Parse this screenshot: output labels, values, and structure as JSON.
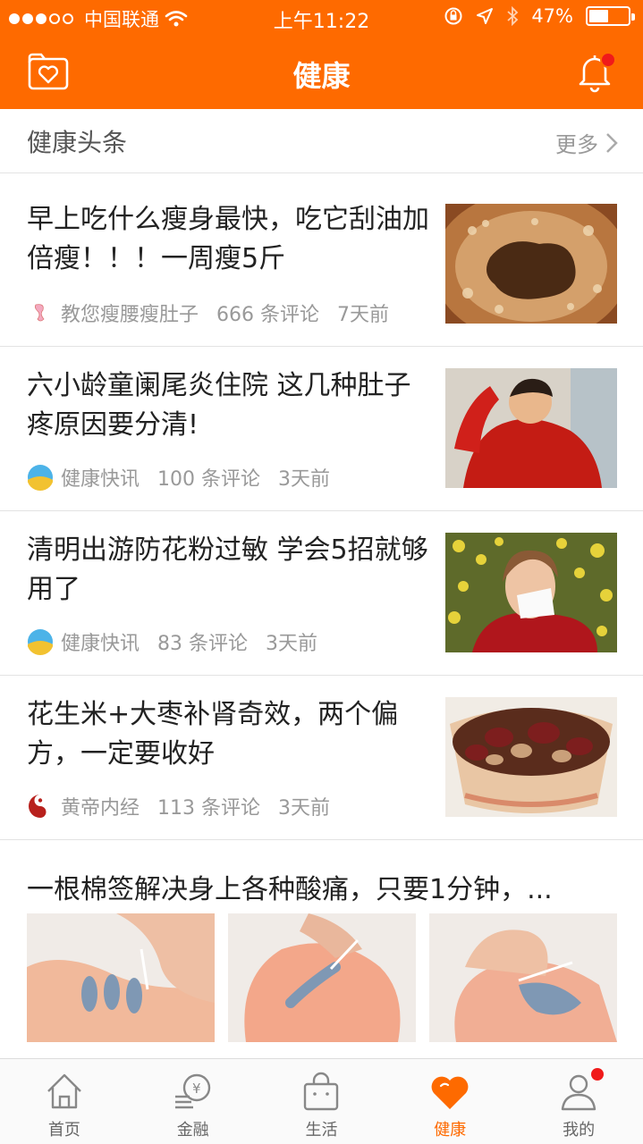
{
  "status_bar": {
    "carrier": "中国联通",
    "time": "上午11:22",
    "battery": "47%"
  },
  "nav": {
    "title": "健康"
  },
  "section": {
    "title": "健康头条",
    "more": "更多"
  },
  "news": [
    {
      "title": "早上吃什么瘦身最快，吃它刮油加倍瘦！！！一周瘦5斤",
      "source": "教您瘦腰瘦肚子",
      "comments": "666 条评论",
      "time": "7天前"
    },
    {
      "title": "六小龄童阑尾炎住院 这几种肚子疼原因要分清!",
      "source": "健康快讯",
      "comments": "100 条评论",
      "time": "3天前"
    },
    {
      "title": "清明出游防花粉过敏 学会5招就够用了",
      "source": "健康快讯",
      "comments": "83 条评论",
      "time": "3天前"
    },
    {
      "title": "花生米+大枣补肾奇效，两个偏方，一定要收好",
      "source": "黄帝内经",
      "comments": "113 条评论",
      "time": "3天前"
    }
  ],
  "wide_news": {
    "title": "一根棉签解决身上各种酸痛，只要1分钟，..."
  },
  "tabs": [
    {
      "label": "首页",
      "icon": "home-icon"
    },
    {
      "label": "金融",
      "icon": "finance-icon"
    },
    {
      "label": "生活",
      "icon": "shopping-bag-icon"
    },
    {
      "label": "健康",
      "icon": "heart-icon"
    },
    {
      "label": "我的",
      "icon": "profile-icon"
    }
  ],
  "colors": {
    "brand": "#fe6a00",
    "badge": "#f01a1a"
  }
}
